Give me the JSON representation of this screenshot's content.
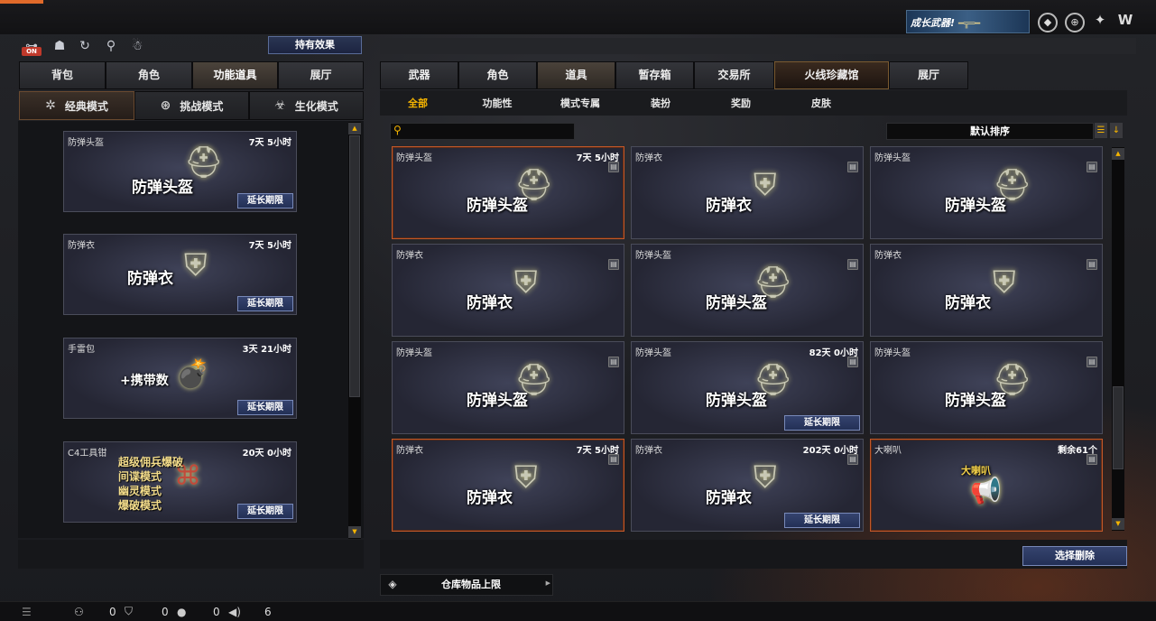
{
  "top": {
    "banner": "成长武器!",
    "icons": [
      "shield-icon",
      "globe-icon",
      "wrench-icon",
      "brand-logo-icon"
    ]
  },
  "left": {
    "effects_button": "持有效果",
    "toolbar_icons": [
      "power-toggle-icon",
      "team-icon",
      "refresh-icon",
      "person-icon",
      "pet-icon"
    ],
    "on_label": "ON",
    "tabs": [
      "背包",
      "角色",
      "功能道具",
      "展厅"
    ],
    "active_tab": 2,
    "modes": [
      {
        "label": "经典模式",
        "icon": "crosshair-icon"
      },
      {
        "label": "挑战模式",
        "icon": "challenge-icon"
      },
      {
        "label": "生化模式",
        "icon": "biohazard-icon"
      }
    ],
    "items": [
      {
        "name": "防弹头盔",
        "time": "7天 5小时",
        "big": "防弹头盔",
        "icon": "helmet-icon",
        "ext": "延长期限"
      },
      {
        "name": "防弹衣",
        "time": "7天 5小时",
        "big": "防弹衣",
        "icon": "vest-icon",
        "ext": "延长期限"
      },
      {
        "name": "手雷包",
        "time": "3天 21小时",
        "big": "+携带数",
        "icon": "grenade-icon",
        "ext": "延长期限"
      },
      {
        "name": "C4工具钳",
        "time": "20天 0小时",
        "lines": [
          "超级佣兵爆破",
          "间谍模式",
          "幽灵模式",
          "爆破模式"
        ],
        "icon": "c4-pliers-icon",
        "ext": "延长期限"
      }
    ]
  },
  "right": {
    "tabs": [
      "武器",
      "角色",
      "道具",
      "暂存箱",
      "交易所",
      "火线珍藏馆",
      "展厅"
    ],
    "active_tab": 2,
    "subtabs": [
      "全部",
      "功能性",
      "模式专属",
      "装扮",
      "奖励",
      "皮肤"
    ],
    "active_subtab": 0,
    "sort_label": "默认排序",
    "grid": [
      {
        "name": "防弹头盔",
        "time": "7天 5小时",
        "big": "防弹头盔",
        "icon": "helmet-icon",
        "selected": true,
        "ext": ""
      },
      {
        "name": "防弹衣",
        "time": "",
        "big": "防弹衣",
        "icon": "vest-icon",
        "selected": false,
        "ext": ""
      },
      {
        "name": "防弹头盔",
        "time": "",
        "big": "防弹头盔",
        "icon": "helmet-icon",
        "selected": false,
        "ext": ""
      },
      {
        "name": "防弹衣",
        "time": "",
        "big": "防弹衣",
        "icon": "vest-icon",
        "selected": false,
        "ext": ""
      },
      {
        "name": "防弹头盔",
        "time": "",
        "big": "防弹头盔",
        "icon": "helmet-icon",
        "selected": false,
        "ext": ""
      },
      {
        "name": "防弹衣",
        "time": "",
        "big": "防弹衣",
        "icon": "vest-icon",
        "selected": false,
        "ext": ""
      },
      {
        "name": "防弹头盔",
        "time": "",
        "big": "防弹头盔",
        "icon": "helmet-icon",
        "selected": false,
        "ext": ""
      },
      {
        "name": "防弹头盔",
        "time": "82天 0小时",
        "big": "防弹头盔",
        "icon": "helmet-icon",
        "selected": false,
        "ext": "延长期限"
      },
      {
        "name": "防弹头盔",
        "time": "",
        "big": "防弹头盔",
        "icon": "helmet-icon",
        "selected": false,
        "ext": ""
      },
      {
        "name": "防弹衣",
        "time": "7天 5小时",
        "big": "防弹衣",
        "icon": "vest-icon",
        "selected": true,
        "ext": ""
      },
      {
        "name": "防弹衣",
        "time": "202天 0小时",
        "big": "防弹衣",
        "icon": "vest-icon",
        "selected": false,
        "ext": "延长期限"
      },
      {
        "name": "大喇叭",
        "time": "剩余61个",
        "big": "大喇叭",
        "icon": "megaphone-icon",
        "selected": true,
        "ext": ""
      }
    ],
    "delete_button": "选择删除",
    "storage_label": "仓库物品上限"
  },
  "status": {
    "counts": [
      "0",
      "0",
      "0",
      "6"
    ]
  }
}
